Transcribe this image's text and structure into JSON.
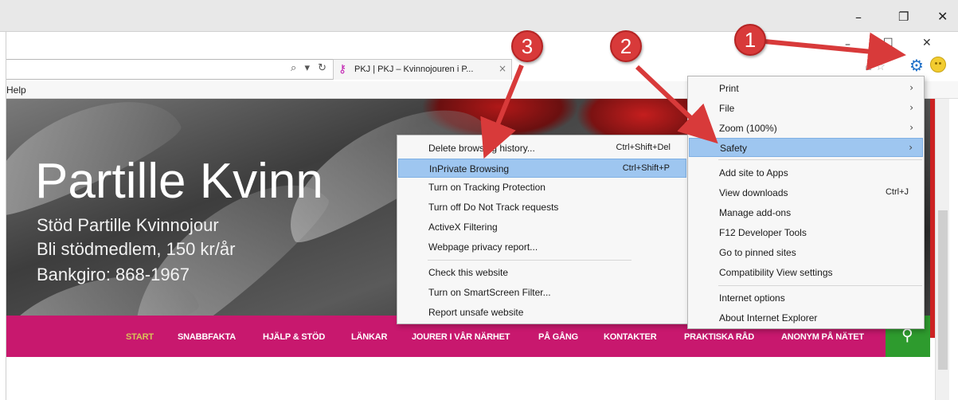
{
  "outer_window": {
    "minimize": "–",
    "restore": "❐",
    "close": "✕"
  },
  "ie_window": {
    "minimize": "–",
    "maximize": "☐",
    "close": "✕"
  },
  "address_bar": {
    "icons": "⌕ ▾ ↻"
  },
  "tab": {
    "title": "PKJ | PKJ – Kvinnojouren i P...",
    "close": "×",
    "icon": "key-icon"
  },
  "menubar": {
    "help": "Help"
  },
  "hero": {
    "title": "Partille Kvinn",
    "lines": [
      "Stöd Partille Kvinnojour",
      "Bli stödmedlem, 150 kr/år",
      "Bankgiro: 868-1967"
    ]
  },
  "nav": {
    "items": [
      "START",
      "SNABBFAKTA",
      "HJÄLP & STÖD",
      "LÄNKAR",
      "JOURER I VÅR NÄRHET",
      "PÅ GÅNG",
      "KONTAKTER",
      "PRAKTISKA RÅD",
      "ANONYM PÅ NÄTET"
    ],
    "active_index": 0,
    "search_icon": "search-icon"
  },
  "tools_menu": {
    "items": [
      {
        "label": "Print",
        "submenu": true
      },
      {
        "label": "File",
        "submenu": true
      },
      {
        "label": "Zoom (100%)",
        "submenu": true
      },
      {
        "label": "Safety",
        "submenu": true,
        "highlighted": true
      },
      {
        "label": "Add site to Apps"
      },
      {
        "label": "View downloads",
        "shortcut": "Ctrl+J"
      },
      {
        "label": "Manage add-ons"
      },
      {
        "label": "F12 Developer Tools"
      },
      {
        "label": "Go to pinned sites"
      },
      {
        "label": "Compatibility View settings"
      },
      {
        "label": "Internet options"
      },
      {
        "label": "About Internet Explorer"
      }
    ]
  },
  "safety_menu": {
    "items": [
      {
        "label": "Delete browsing history...",
        "shortcut": "Ctrl+Shift+Del"
      },
      {
        "label": "InPrivate Browsing",
        "shortcut": "Ctrl+Shift+P",
        "highlighted": true
      },
      {
        "label": "Turn on Tracking Protection"
      },
      {
        "label": "Turn off Do Not Track requests"
      },
      {
        "label": "ActiveX Filtering"
      },
      {
        "label": "Webpage privacy report..."
      },
      {
        "label": "Check this website"
      },
      {
        "label": "Turn on SmartScreen Filter..."
      },
      {
        "label": "Report unsafe website"
      }
    ]
  },
  "callouts": [
    "1",
    "2",
    "3"
  ],
  "colors": {
    "nav_bg": "#c8186e",
    "nav_active": "#d7c35a",
    "search_bg": "#2e9b2e",
    "highlight": "#9ec6f0",
    "callout": "#d83a3a"
  }
}
